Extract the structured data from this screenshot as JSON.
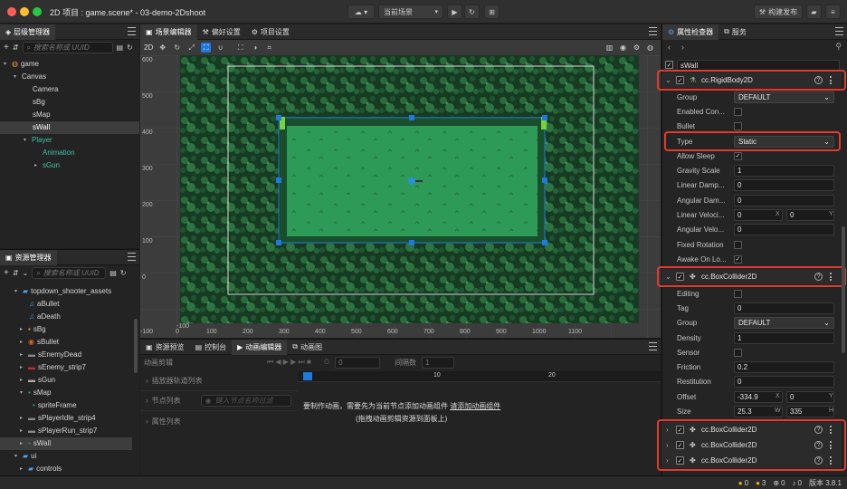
{
  "window": {
    "title": "2D 项目 : game.scene* - 03-demo-2Dshoot",
    "scene_select": "当前场景",
    "build_button": "构建发布"
  },
  "hierarchy": {
    "title": "层级管理器",
    "search_placeholder": "搜索名称或 UUID",
    "nodes": [
      "game",
      "Canvas",
      "Camera",
      "sBg",
      "sMap",
      "sWall",
      "Player",
      "Animation",
      "sGun"
    ],
    "selected": "sWall"
  },
  "assets": {
    "title": "资源管理器",
    "search_placeholder": "搜索名称或 UUID",
    "items": [
      "topdown_shooter_assets",
      "aBullet",
      "aDeath",
      "sBg",
      "sBullet",
      "sEnemyDead",
      "sEnemy_strip7",
      "sGun",
      "sMap",
      "spriteFrame",
      "sPlayerIdle_strip4",
      "sPlayerRun_strip7",
      "sWall",
      "ui",
      "controls"
    ]
  },
  "scene": {
    "tabs": [
      "场景编辑器",
      "偏好设置",
      "项目设置"
    ],
    "mode": "2D",
    "y_ticks": [
      "600",
      "500",
      "400",
      "300",
      "200",
      "100",
      "0",
      "-100"
    ],
    "x_ticks": [
      "-100",
      "0",
      "100",
      "200",
      "300",
      "400",
      "500",
      "600",
      "700",
      "800",
      "900",
      "1000",
      "1100"
    ]
  },
  "bottom": {
    "tabs": [
      "资源预览",
      "控制台",
      "动画编辑器",
      "动画图"
    ],
    "clip_label": "动画剪辑",
    "time_value": "0",
    "interval_label": "间隔数",
    "interval_value": "1",
    "ruler_marks": [
      "0",
      "10",
      "20"
    ],
    "sections": [
      "插放器轨道列表",
      "节点列表",
      "属性列表"
    ],
    "filter_placeholder": "键入节点名称过滤",
    "message_line1_prefix": "要制作动画，需要先为当前节点添加动画组件",
    "message_link": "请添加动画组件",
    "message_line2": "(拖拽动画剪辑资源到面板上)"
  },
  "inspector": {
    "tabs": [
      "属性检查器",
      "服务"
    ],
    "node_name": "sWall",
    "rigidbody": {
      "title": "cc.RigidBody2D",
      "group_label": "Group",
      "group_value": "DEFAULT",
      "enabled_contact_label": "Enabled Con...",
      "bullet_label": "Bullet",
      "type_label": "Type",
      "type_value": "Static",
      "allow_sleep_label": "Allow Sleep",
      "gravity_label": "Gravity Scale",
      "gravity_value": "1",
      "linear_damp_label": "Linear Damp...",
      "linear_damp_value": "0",
      "angular_damp_label": "Angular Dam...",
      "angular_damp_value": "0",
      "linear_vel_label": "Linear Veloci...",
      "linear_vel_x": "0",
      "linear_vel_y": "0",
      "angular_vel_label": "Angular Velo...",
      "angular_vel_value": "0",
      "fixed_rotation_label": "Fixed Rotation",
      "awake_label": "Awake On Lo..."
    },
    "box1": {
      "title": "cc.BoxCollider2D",
      "editing_label": "Editing",
      "tag_label": "Tag",
      "tag_value": "0",
      "group_label": "Group",
      "group_value": "DEFAULT",
      "density_label": "Density",
      "density_value": "1",
      "sensor_label": "Sensor",
      "friction_label": "Friction",
      "friction_value": "0.2",
      "restitution_label": "Restitution",
      "restitution_value": "0",
      "offset_label": "Offset",
      "offset_x": "-334.9",
      "offset_y": "0",
      "size_label": "Size",
      "size_w": "25.3",
      "size_h": "335"
    },
    "extra_components": [
      "cc.BoxCollider2D",
      "cc.BoxCollider2D",
      "cc.BoxCollider2D"
    ],
    "axis_x": "X",
    "axis_y": "Y",
    "axis_w": "W",
    "axis_h": "H"
  },
  "statusbar": {
    "errors": "0",
    "warnings": "3",
    "failures": "0",
    "notices": "0",
    "version": "版本 3.8.1"
  },
  "colors": {
    "accent": "#1f7ae0",
    "highlight": "#e53a2b",
    "scene_grass": "#2f9b58"
  }
}
